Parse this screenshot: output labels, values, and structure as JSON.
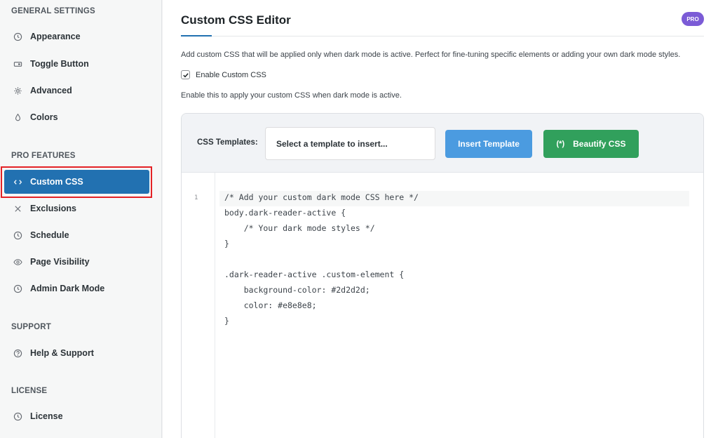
{
  "sidebar": {
    "sections": [
      {
        "title": "GENERAL SETTINGS"
      },
      {
        "title": "PRO FEATURES"
      },
      {
        "title": "SUPPORT"
      },
      {
        "title": "LICENSE"
      }
    ],
    "items": [
      {
        "label": "Appearance",
        "icon": "clock-icon"
      },
      {
        "label": "Toggle Button",
        "icon": "toggle-icon"
      },
      {
        "label": "Advanced",
        "icon": "gear-icon"
      },
      {
        "label": "Colors",
        "icon": "droplet-icon"
      },
      {
        "label": "Custom CSS",
        "icon": "code-icon",
        "active": true
      },
      {
        "label": "Exclusions",
        "icon": "close-icon"
      },
      {
        "label": "Schedule",
        "icon": "clock-icon"
      },
      {
        "label": "Page Visibility",
        "icon": "eye-icon"
      },
      {
        "label": "Admin Dark Mode",
        "icon": "clock-icon"
      },
      {
        "label": "Help & Support",
        "icon": "question-icon"
      },
      {
        "label": "License",
        "icon": "clock-icon"
      }
    ]
  },
  "header": {
    "title": "Custom CSS Editor",
    "badge": "PRO"
  },
  "main": {
    "description": "Add custom CSS that will be applied only when dark mode is active. Perfect for fine-tuning specific elements or adding your own dark mode styles.",
    "enable_label": "Enable Custom CSS",
    "enable_checked": true,
    "help_text": "Enable this to apply your custom CSS when dark mode is active."
  },
  "editor": {
    "templates_label": "CSS Templates:",
    "select_placeholder": "Select a template to insert...",
    "insert_button": "Insert Template",
    "beautify_button": "Beautify CSS",
    "beautify_icon": "(*)",
    "line_numbers": [
      "1"
    ],
    "code_lines": [
      "/* Add your custom dark mode CSS here */",
      "body.dark-reader-active {",
      "    /* Your dark mode styles */",
      "}",
      "",
      ".dark-reader-active .custom-element {",
      "    background-color: #2d2d2d;",
      "    color: #e8e8e8;",
      "}"
    ]
  },
  "colors": {
    "accent": "#2271b1",
    "pro_badge": "#7b5bd6",
    "insert_button": "#4b9be0",
    "beautify_button": "#31a05c",
    "highlight_border": "#e32226"
  }
}
